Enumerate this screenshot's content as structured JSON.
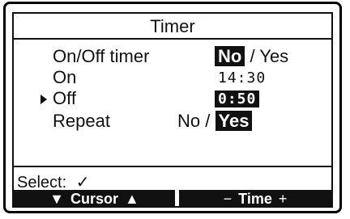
{
  "title": "Timer",
  "rows": {
    "onoff_timer": {
      "label": "On/Off timer",
      "selected": "No",
      "sep": "/",
      "other": "Yes"
    },
    "on": {
      "label": "On",
      "value": "14:30"
    },
    "off": {
      "label": "Off",
      "value": "0:50",
      "pointer": "▶"
    },
    "repeat": {
      "label": "Repeat",
      "other": "No",
      "sep": "/",
      "selected": "Yes"
    }
  },
  "footer": {
    "select_label": "Select:",
    "select_icon": "✓"
  },
  "softkeys": {
    "cursor": {
      "left_icon": "▼",
      "label": "Cursor",
      "right_icon": "▲"
    },
    "time": {
      "left_icon": "−",
      "label": "Time",
      "right_icon": "+"
    }
  }
}
